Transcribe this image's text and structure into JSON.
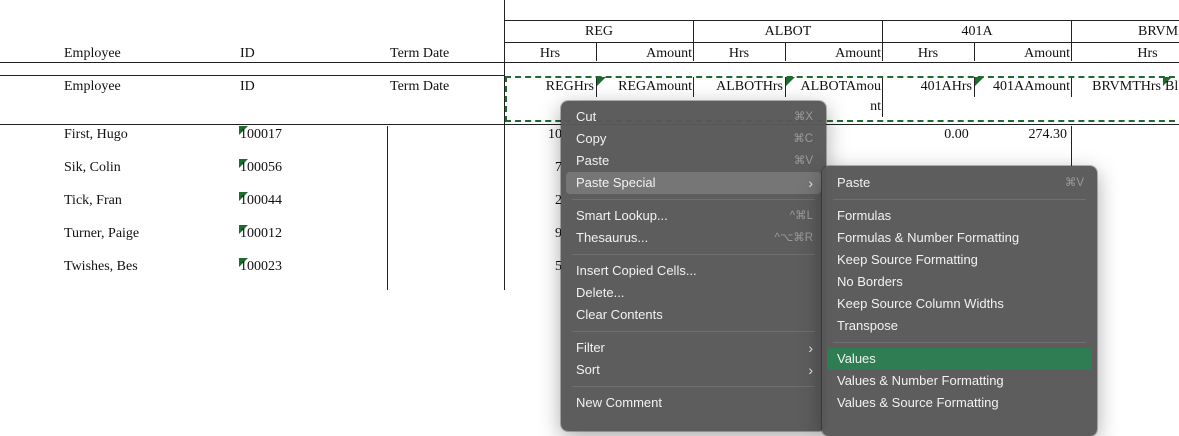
{
  "sheet": {
    "group_headers": [
      "REG",
      "ALBOT",
      "401A",
      "BRVM"
    ],
    "header_row": {
      "employee": "Employee",
      "id": "ID",
      "term_date": "Term Date",
      "reg_hrs": "Hrs",
      "reg_amount": "Amount",
      "albot_hrs": "Hrs",
      "albot_amount": "Amount",
      "a401_hrs": "Hrs",
      "a401_amount": "Amount",
      "brvm_hrs": "Hrs"
    },
    "code_row": {
      "employee": "Employee",
      "id": "ID",
      "term_date": "Term Date",
      "reg_hrs": "REGHrs",
      "reg_amount": "REGAmount",
      "albot_hrs": "ALBOTHrs",
      "albot_amount_line1": "ALBOTAmou",
      "albot_amount_line2": "nt",
      "a401_hrs": "401AHrs",
      "a401_amount": "401AAmount",
      "brvm_hrs": "BRVMTHrs",
      "brvm_next": "Bl"
    },
    "rows": [
      {
        "name": "First, Hugo",
        "id": "100017",
        "reg_partial": "10",
        "a401_hrs": "0.00",
        "a401_amount": "274.30"
      },
      {
        "name": "Sik, Colin",
        "id": "100056",
        "reg_partial": "7",
        "a401_hrs": "",
        "a401_amount": ""
      },
      {
        "name": "Tick, Fran",
        "id": "100044",
        "reg_partial": "2",
        "a401_hrs": "",
        "a401_amount": ""
      },
      {
        "name": "Turner, Paige",
        "id": "100012",
        "reg_partial": "9",
        "a401_hrs": "",
        "a401_amount": ""
      },
      {
        "name": "Twishes, Bes",
        "id": "100023",
        "reg_partial": "5",
        "a401_hrs": "",
        "a401_amount": ""
      }
    ]
  },
  "context_menu": {
    "items": [
      {
        "label": "Cut",
        "shortcut": "⌘X"
      },
      {
        "label": "Copy",
        "shortcut": "⌘C"
      },
      {
        "label": "Paste",
        "shortcut": "⌘V"
      },
      {
        "label": "Paste Special",
        "submenu": true
      },
      {
        "label": "Smart Lookup...",
        "shortcut": "^⌘L"
      },
      {
        "label": "Thesaurus...",
        "shortcut": "^⌥⌘R"
      },
      {
        "label": "Insert Copied Cells..."
      },
      {
        "label": "Delete..."
      },
      {
        "label": "Clear Contents"
      },
      {
        "label": "Filter",
        "submenu": true
      },
      {
        "label": "Sort",
        "submenu": true
      },
      {
        "label": "New Comment"
      }
    ]
  },
  "paste_special_menu": {
    "items": [
      {
        "label": "Paste",
        "shortcut": "⌘V"
      },
      {
        "label": "Formulas"
      },
      {
        "label": "Formulas & Number Formatting"
      },
      {
        "label": "Keep Source Formatting"
      },
      {
        "label": "No Borders"
      },
      {
        "label": "Keep Source Column Widths"
      },
      {
        "label": "Transpose"
      },
      {
        "label": "Values"
      },
      {
        "label": "Values & Number Formatting"
      },
      {
        "label": "Values & Source Formatting"
      }
    ],
    "highlighted": "Values"
  },
  "colors": {
    "comment_marker": "#1e6b2e",
    "menu_highlight": "#2f7d52",
    "copy_border": "#1e6b2e"
  }
}
